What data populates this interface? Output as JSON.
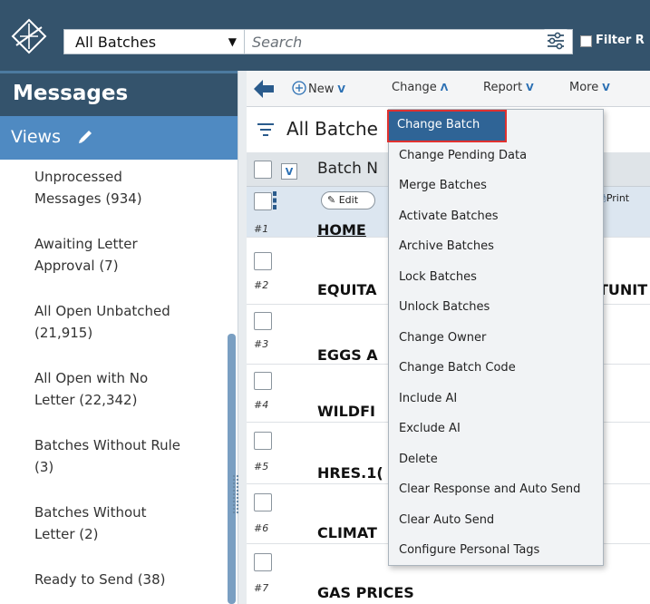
{
  "topbar": {
    "view_value": "All Batches",
    "search_placeholder": "Search",
    "filter_label": "Filter R"
  },
  "sidebar": {
    "title": "Messages",
    "views_label": "Views",
    "items": [
      {
        "line1": "Unprocessed",
        "line2": "Messages (934)"
      },
      {
        "line1": "Awaiting Letter",
        "line2": "Approval (7)"
      },
      {
        "line1": "All Open Unbatched",
        "line2": "(21,915)"
      },
      {
        "line1": "All Open with No",
        "line2": "Letter (22,342)"
      },
      {
        "line1": "Batches Without Rule",
        "line2": "(3)"
      },
      {
        "line1": "Batches Without",
        "line2": "Letter (2)"
      },
      {
        "line1": "Ready to Send (38)",
        "line2": ""
      }
    ]
  },
  "toolbar": {
    "new_label": "New",
    "change_label": "Change",
    "report_label": "Report",
    "more_label": "More"
  },
  "main": {
    "title": "All Batche",
    "column_label": "Batch N",
    "edit_label": "Edit",
    "print_label": "Print",
    "rows": [
      {
        "num": "#1",
        "name": "HOME"
      },
      {
        "num": "#2",
        "name": "EQUITA",
        "trailing": "TUNIT"
      },
      {
        "num": "#3",
        "name": "EGGS A"
      },
      {
        "num": "#4",
        "name": "WILDFI"
      },
      {
        "num": "#5",
        "name": "HRES.1("
      },
      {
        "num": "#6",
        "name": "CLIMAT"
      },
      {
        "num": "#7",
        "name": "GAS PRICES"
      }
    ]
  },
  "change_menu": {
    "items": [
      "Change Batch",
      "Change Pending Data",
      "Merge Batches",
      "Activate Batches",
      "Archive Batches",
      "Lock Batches",
      "Unlock Batches",
      "Change Owner",
      "Change Batch Code",
      "Include AI",
      "Exclude AI",
      "Delete",
      "Clear Response and Auto Send",
      "Clear Auto Send",
      "Configure Personal Tags"
    ],
    "highlighted_index": 0
  },
  "colors": {
    "topbar": "#34536c",
    "views_bar": "#4f8ac2",
    "menu_highlight": "#2f6496",
    "highlight_outline": "#e0312f",
    "accent": "#2a6fb3"
  }
}
